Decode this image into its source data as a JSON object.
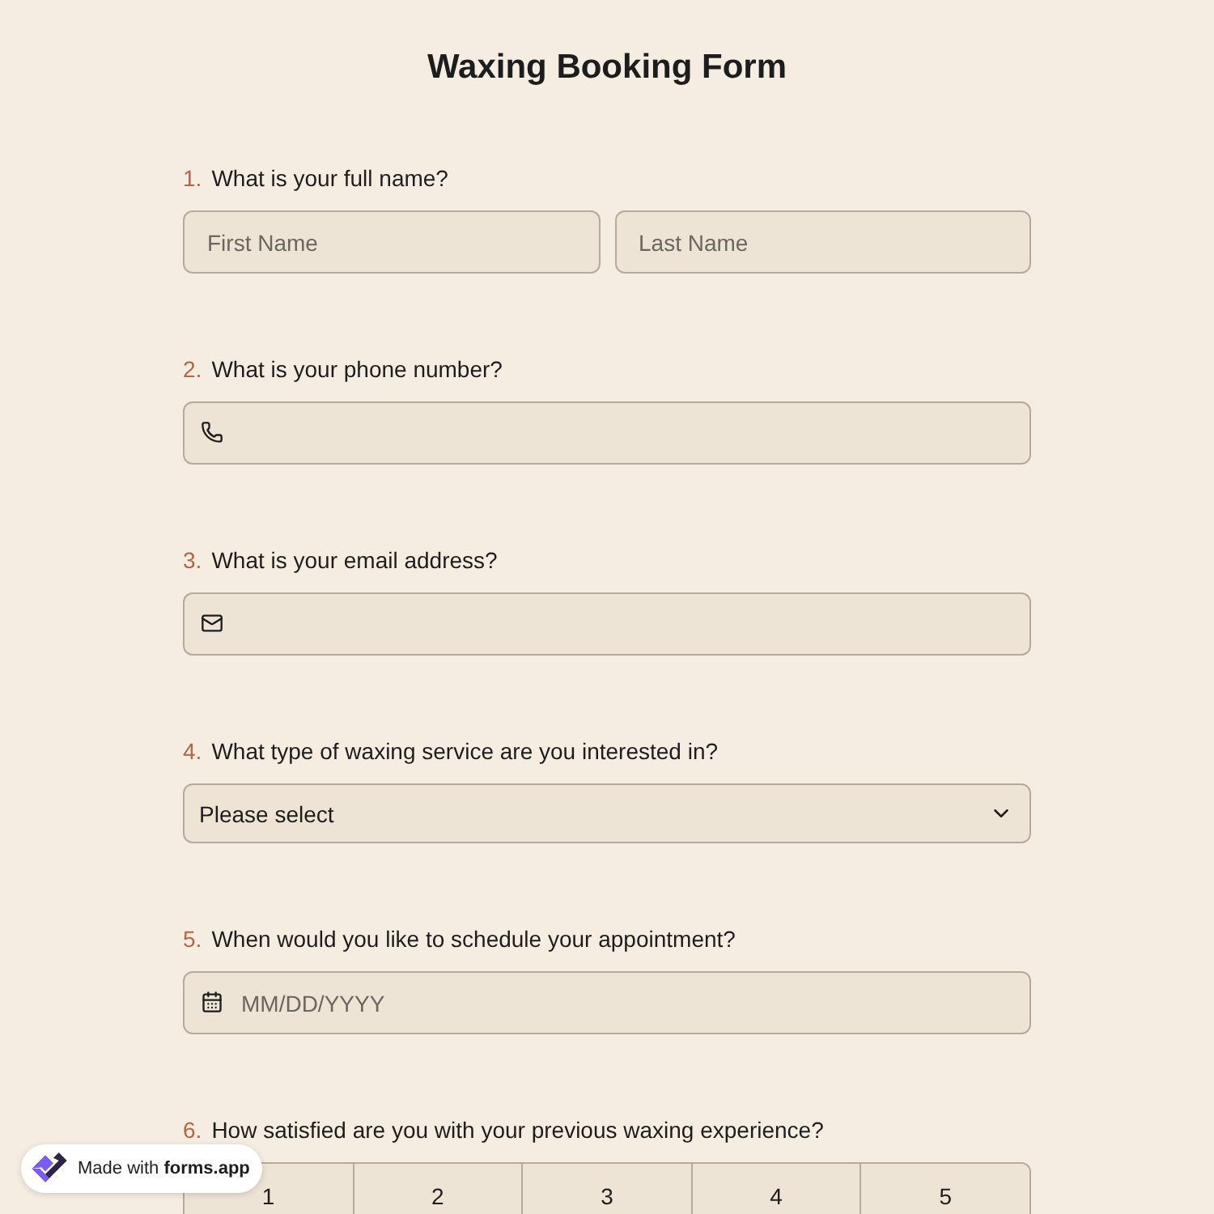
{
  "title": "Waxing Booking Form",
  "questions": [
    {
      "number": "1.",
      "label": "What is your full name?",
      "kind": "name",
      "placeholders": [
        "First Name",
        "Last Name"
      ]
    },
    {
      "number": "2.",
      "label": "What is your phone number?",
      "kind": "phone"
    },
    {
      "number": "3.",
      "label": "What is your email address?",
      "kind": "email"
    },
    {
      "number": "4.",
      "label": "What type of waxing service are you interested in?",
      "kind": "select",
      "value": "Please select"
    },
    {
      "number": "5.",
      "label": "When would you like to schedule your appointment?",
      "kind": "date",
      "placeholder": "MM/DD/YYYY"
    },
    {
      "number": "6.",
      "label": "How satisfied are you with your previous waxing experience?",
      "kind": "scale",
      "options": [
        "1",
        "2",
        "3",
        "4",
        "5"
      ]
    }
  ],
  "badge": {
    "text": "Made with **forms.app**"
  }
}
